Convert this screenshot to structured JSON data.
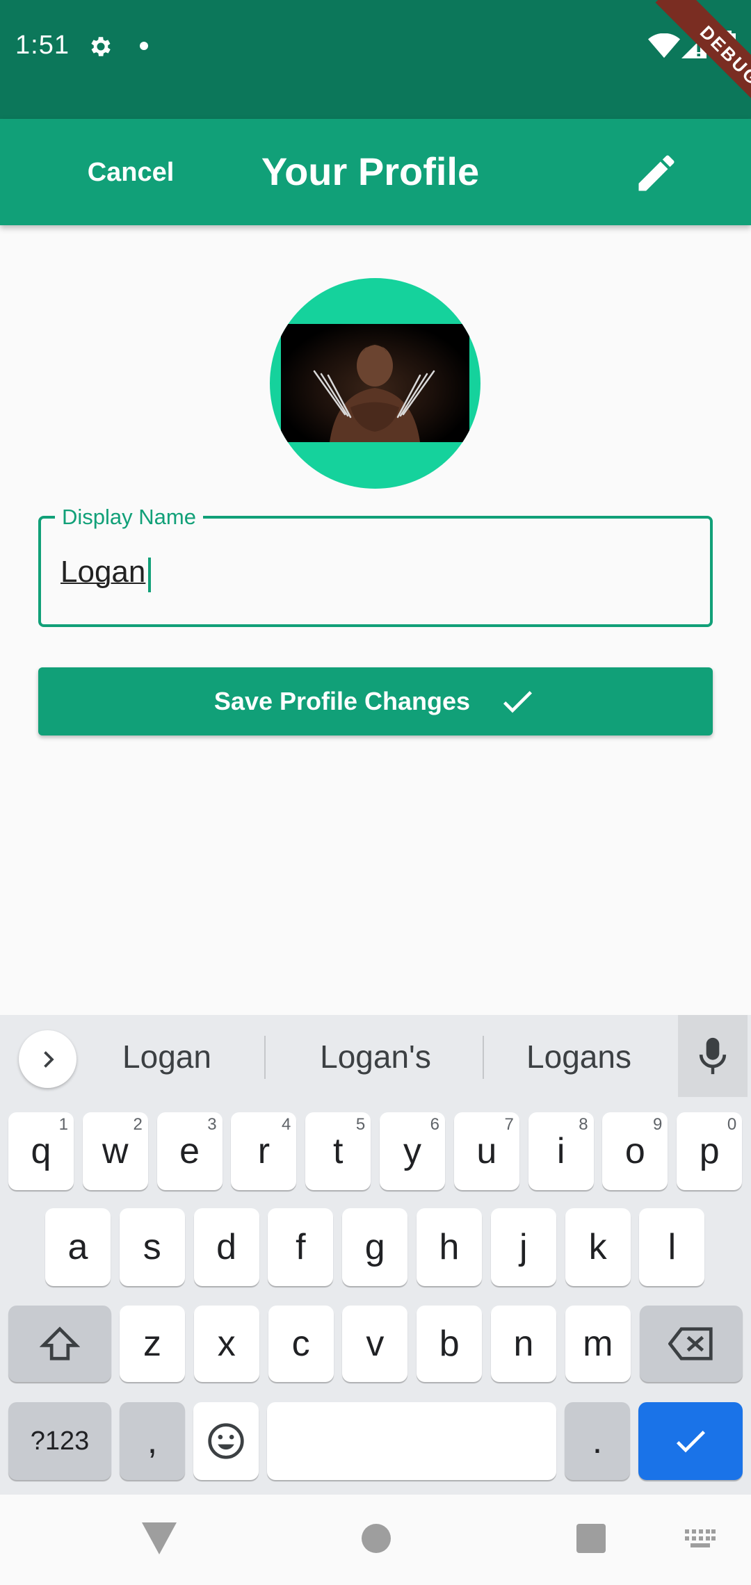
{
  "status_bar": {
    "time": "1:51",
    "debug_label": "DEBUG"
  },
  "app_bar": {
    "cancel_label": "Cancel",
    "title": "Your Profile",
    "edit_icon": "pencil-icon"
  },
  "colors": {
    "status_bar": "#0c775a",
    "primary": "#11a078",
    "avatar_ring": "#15d29c",
    "enter_key": "#1a73e8"
  },
  "form": {
    "display_name_label": "Display Name",
    "display_name_value": "Logan",
    "save_label": "Save Profile Changes"
  },
  "keyboard": {
    "suggestions": [
      "Logan",
      "Logan's",
      "Logans"
    ],
    "row1": [
      {
        "k": "q",
        "n": "1"
      },
      {
        "k": "w",
        "n": "2"
      },
      {
        "k": "e",
        "n": "3"
      },
      {
        "k": "r",
        "n": "4"
      },
      {
        "k": "t",
        "n": "5"
      },
      {
        "k": "y",
        "n": "6"
      },
      {
        "k": "u",
        "n": "7"
      },
      {
        "k": "i",
        "n": "8"
      },
      {
        "k": "o",
        "n": "9"
      },
      {
        "k": "p",
        "n": "0"
      }
    ],
    "row2": [
      "a",
      "s",
      "d",
      "f",
      "g",
      "h",
      "j",
      "k",
      "l"
    ],
    "row3": [
      "z",
      "x",
      "c",
      "v",
      "b",
      "n",
      "m"
    ],
    "symbols_label": "?123",
    "comma_label": ",",
    "period_label": "."
  }
}
